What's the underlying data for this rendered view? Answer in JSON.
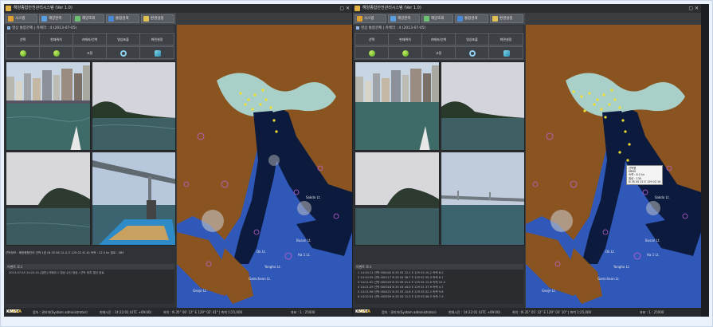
{
  "left_app": {
    "title": "해양종합안전관리시스템 (Ver 1.0)",
    "win_controls": "▢ ✕",
    "toolbar": [
      {
        "label": "시스템",
        "icon": "system-icon",
        "color": "#e0a030"
      },
      {
        "label": "해양관측",
        "icon": "ocean-icon",
        "color": "#5aa0e0"
      },
      {
        "label": "해양조회",
        "icon": "search-icon",
        "color": "#6cc070"
      },
      {
        "label": "통합검색",
        "icon": "database-icon",
        "color": "#4a88d8"
      },
      {
        "label": "환경설정",
        "icon": "settings-icon",
        "color": "#e0c050"
      }
    ],
    "panel_title": "영상 통합관제",
    "panel_subtitle": "| 카메라 : 4 (2013-07-05)",
    "grid_headers": [
      "선택",
      "현재위치",
      "카메라/선박",
      "영상표출",
      "화면설정"
    ],
    "grid_icons": [
      "green-dot-icon",
      "green-dot-icon",
      "mode-text",
      "refresh-icon",
      "tool-icon"
    ],
    "grid_mode_text": "고정",
    "info_text": "선박정보 : 해양종합관리 선박 1호 (N 35 06 12.4, E 129 02 41.6)  속력 : 12.3 kn  침로 : 085",
    "log_title": "이벤트 로그",
    "log_lines": [
      "2013-07-05 14:22:01  [일반] 카메라 1 영상 수신 정상 / 선박 위치 갱신 완료"
    ],
    "status": {
      "logo_main": "KMST",
      "logo_sub": "KOREA",
      "items": [
        "접속 : 관리자(System administrator)",
        "현재시간 : 14:22:01 (UTC +09:00)",
        "위치 : N 35° 06' 12\" E 129° 02' 41\" | 축척 1:25,000",
        "좌표 : 1 : 25000"
      ]
    }
  },
  "right_app": {
    "title": "해양종합안전관리시스템 (Ver 1.0)",
    "win_controls": "▢ ✕",
    "toolbar": [
      {
        "label": "시스템",
        "icon": "system-icon",
        "color": "#e0a030"
      },
      {
        "label": "해양관측",
        "icon": "ocean-icon",
        "color": "#5aa0e0"
      },
      {
        "label": "해양조회",
        "icon": "search-icon",
        "color": "#6cc070"
      },
      {
        "label": "통합검색",
        "icon": "database-icon",
        "color": "#4a88d8"
      },
      {
        "label": "환경설정",
        "icon": "settings-icon",
        "color": "#e0c050"
      }
    ],
    "panel_title": "영상 통합관제",
    "panel_subtitle": "| 카메라 : 4 (2013-07-05)",
    "grid_headers": [
      "선택",
      "현재위치",
      "카메라/선박",
      "영상표출",
      "화면설정"
    ],
    "grid_icons": [
      "green-dot-icon",
      "green-dot-icon",
      "mode-text",
      "refresh-icon",
      "tool-icon"
    ],
    "grid_mode_text": "고정",
    "info_text": "",
    "log_title": "이벤트 로그",
    "log_lines": [
      "1  14:20:11  선박 000042  N 35 05 22.1  E 129 03 10.2  속력 8.2",
      "2  14:20:35  선박 000117  N 35 04 58.7  E 129 02 55.3  속력 6.1",
      "3  14:21:02  선박 000203  N 35 06 01.4  E 129 04 12.8  속력 10.4",
      "4  14:21:29  선박 000318  N 35 03 44.0  E 129 01 37.9  속력 4.7",
      "5  14:21:56  선박 000421  N 35 05 10.6  E 129 05 02.2  속력 9.8",
      "6  14:22:01  선박 000509  N 35 04 12.3  E 129 03 48.5  속력 7.3"
    ],
    "popup_lines": [
      "선박명",
      "MMSI",
      "속력 : 8.2 kn",
      "침로 : 135",
      "N 35 05 22 E 129 03 10"
    ],
    "status": {
      "logo_main": "KMST",
      "logo_sub": "KOREA",
      "items": [
        "접속 : 관리자(System administrator)",
        "현재시간 : 14:22:01 (UTC +09:00)",
        "위치 : N 35° 05' 22\" E 129° 03' 10\" | 축척 1:25,000",
        "좌표 : 1 : 25000"
      ]
    }
  },
  "map_labels": {
    "left": [
      "Sakdo Lt.",
      "Busan Lt.",
      "Ha 1 Lt.",
      "Ok Lt.",
      "Yongho Lt.",
      "Gamcheon Lt.",
      "Geoje Lt."
    ],
    "right": [
      "Sakdo Lt.",
      "Busan Lt.",
      "Ha 1 Lt.",
      "Ok Lt.",
      "Yongho Lt.",
      "Gamcheon Lt.",
      "Geoje Lt."
    ]
  },
  "colors": {
    "land": "#8a5420",
    "shallow": "#2f58b8",
    "deep": "#0b1a3d",
    "inner_bay": "#a8cfc8",
    "vessel": "#f2e030"
  }
}
